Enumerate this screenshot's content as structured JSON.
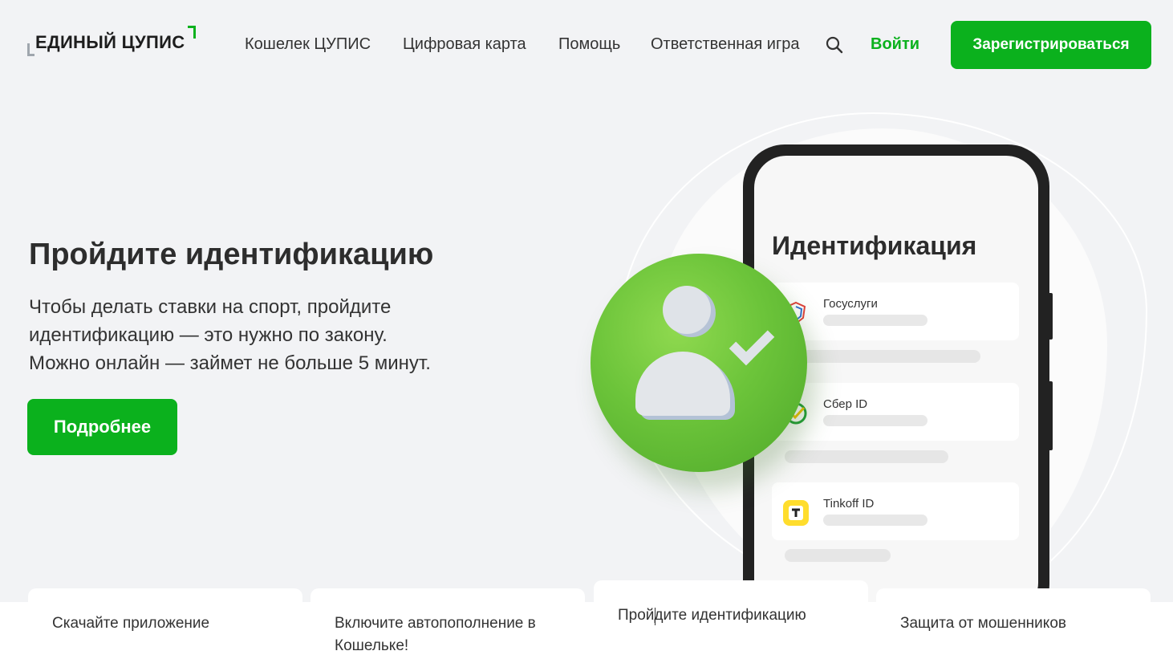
{
  "header": {
    "logo_text": "ЕДИНЫЙ ЦУПИС",
    "nav": [
      "Кошелек ЦУПИС",
      "Цифровая карта",
      "Помощь",
      "Ответственная игра"
    ],
    "login_label": "Войти",
    "register_label": "Зарегистрироваться"
  },
  "hero": {
    "title": "Пройдите идентификацию",
    "text_lines": [
      "Чтобы делать ставки на спорт, пройдите",
      "идентификацию — это нужно по закону.",
      "Можно онлайн — займет не больше 5 минут."
    ],
    "button_label": "Подробнее"
  },
  "phone": {
    "screen_title": "Идентификация",
    "options": [
      {
        "label": "Госуслуги",
        "icon": "gosuslugi-icon"
      },
      {
        "label": "Сбер ID",
        "icon": "sber-id-icon"
      },
      {
        "label": "Tinkoff ID",
        "icon": "tinkoff-id-icon"
      }
    ]
  },
  "tabs": [
    {
      "label": "Скачайте приложение"
    },
    {
      "label": "Включите автопополнение в Кошельке!"
    },
    {
      "label": "Пройдите идентификацию",
      "active": true
    },
    {
      "label": "Защита от мошенников"
    }
  ],
  "colors": {
    "brand_green": "#0bb11d",
    "background": "#f2f3f5"
  }
}
